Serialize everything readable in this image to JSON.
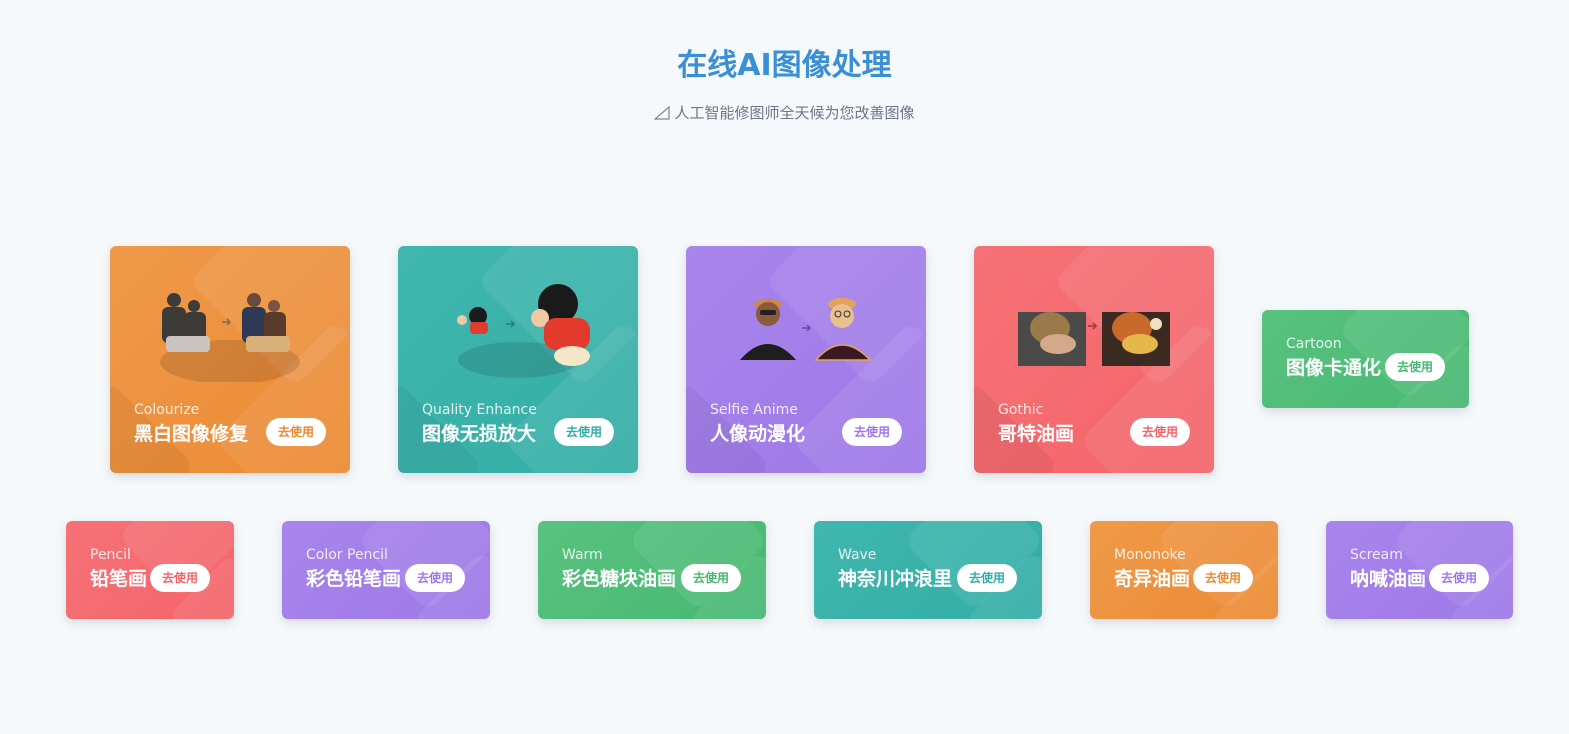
{
  "header": {
    "title": "在线AI图像处理",
    "subtitle": "人工智能修图师全天候为您改善图像"
  },
  "featured_tools": [
    {
      "en": "Colourize",
      "cn": "黑白图像修复",
      "button": "去使用",
      "color": "#ec8933",
      "icon": "colourize-preview-image"
    },
    {
      "en": "Quality Enhance",
      "cn": "图像无损放大",
      "button": "去使用",
      "color": "#33ada6",
      "icon": "enhance-preview-image"
    },
    {
      "en": "Selfie Anime",
      "cn": "人像动漫化",
      "button": "去使用",
      "color": "#9d78e8",
      "icon": "anime-preview-image"
    },
    {
      "en": "Gothic",
      "cn": "哥特油画",
      "button": "去使用",
      "color": "#f3646a",
      "icon": "gothic-preview-image"
    },
    {
      "en": "Cartoon",
      "cn": "图像卡通化",
      "button": "去使用",
      "color": "#46b872",
      "icon": ""
    }
  ],
  "style_tools": [
    {
      "en": "Pencil",
      "cn": "铅笔画",
      "button": "去使用",
      "color": "#f3646a"
    },
    {
      "en": "Color Pencil",
      "cn": "彩色铅笔画",
      "button": "去使用",
      "color": "#9d78e8"
    },
    {
      "en": "Warm",
      "cn": "彩色糖块油画",
      "button": "去使用",
      "color": "#46b872"
    },
    {
      "en": "Wave",
      "cn": "神奈川冲浪里",
      "button": "去使用",
      "color": "#33ada6"
    },
    {
      "en": "Mononoke",
      "cn": "奇异油画",
      "button": "去使用",
      "color": "#ec8933"
    },
    {
      "en": "Scream",
      "cn": "呐喊油画",
      "button": "去使用",
      "color": "#9d78e8"
    }
  ]
}
